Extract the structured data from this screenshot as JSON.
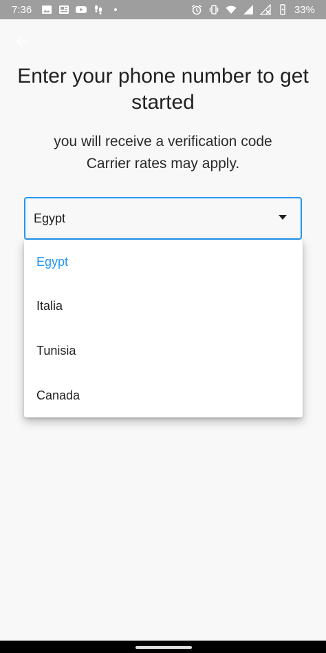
{
  "status_bar": {
    "time": "7:36",
    "battery": "33%",
    "icons_left": [
      "image-icon",
      "news-icon",
      "youtube-icon",
      "footprints-icon",
      "dot-icon"
    ],
    "icons_right": [
      "alarm-icon",
      "vibrate-icon",
      "wifi-icon",
      "signal-icon",
      "no-signal-icon",
      "battery-icon"
    ]
  },
  "header": {
    "title": "Enter your phone number to get started",
    "subtitle_line1": "you will receive a verification code",
    "subtitle_line2": "Carrier rates may apply."
  },
  "country_select": {
    "value": "Egypt",
    "options": [
      "Egypt",
      "Italia",
      "Tunisia",
      "Canada"
    ],
    "selected_index": 0
  },
  "colors": {
    "accent": "#2196f3",
    "background": "#f8f8f8",
    "status_bar": "#9e9e9e"
  }
}
